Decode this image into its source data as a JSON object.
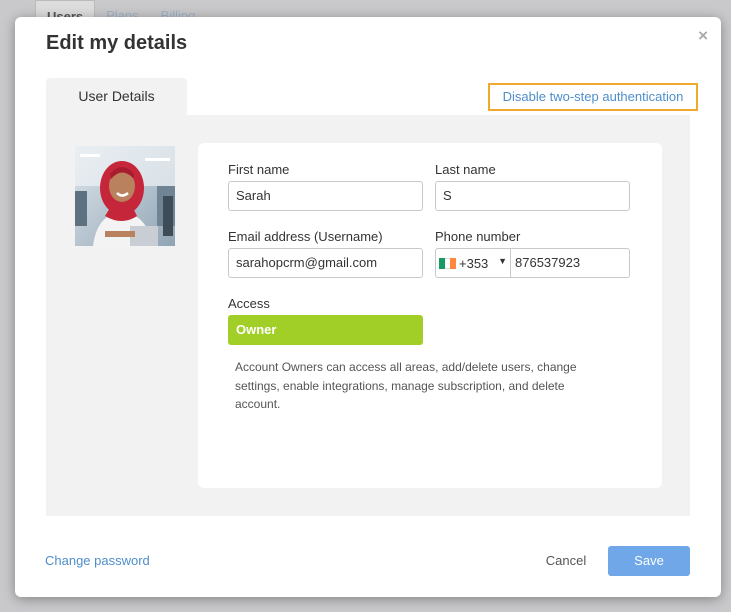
{
  "background": {
    "tabs": [
      "Users",
      "Plans",
      "Billing"
    ]
  },
  "modal": {
    "title": "Edit my details",
    "close_label": "×",
    "tab_label": "User Details",
    "disable_2fa_label": "Disable two-step authentication"
  },
  "form": {
    "first_name_label": "First name",
    "first_name_value": "Sarah",
    "last_name_label": "Last name",
    "last_name_value": "S",
    "email_label": "Email address (Username)",
    "email_value": "sarahopcrm@gmail.com",
    "phone_label": "Phone number",
    "country_code": "+353",
    "phone_value": "876537923",
    "access_label": "Access",
    "access_value": "Owner",
    "access_description": "Account Owners can access all areas, add/delete users, change settings, enable integrations, manage subscription, and delete account."
  },
  "footer": {
    "change_password_label": "Change password",
    "cancel_label": "Cancel",
    "save_label": "Save"
  },
  "colors": {
    "accent_link": "#4e8ecb",
    "highlight_border": "#f0a92e",
    "access_green": "#a2cf27",
    "save_blue": "#6fa7e8"
  },
  "icons": {
    "close": "close-icon",
    "flag": "ireland-flag-icon",
    "dropdown": "chevron-down-icon"
  }
}
